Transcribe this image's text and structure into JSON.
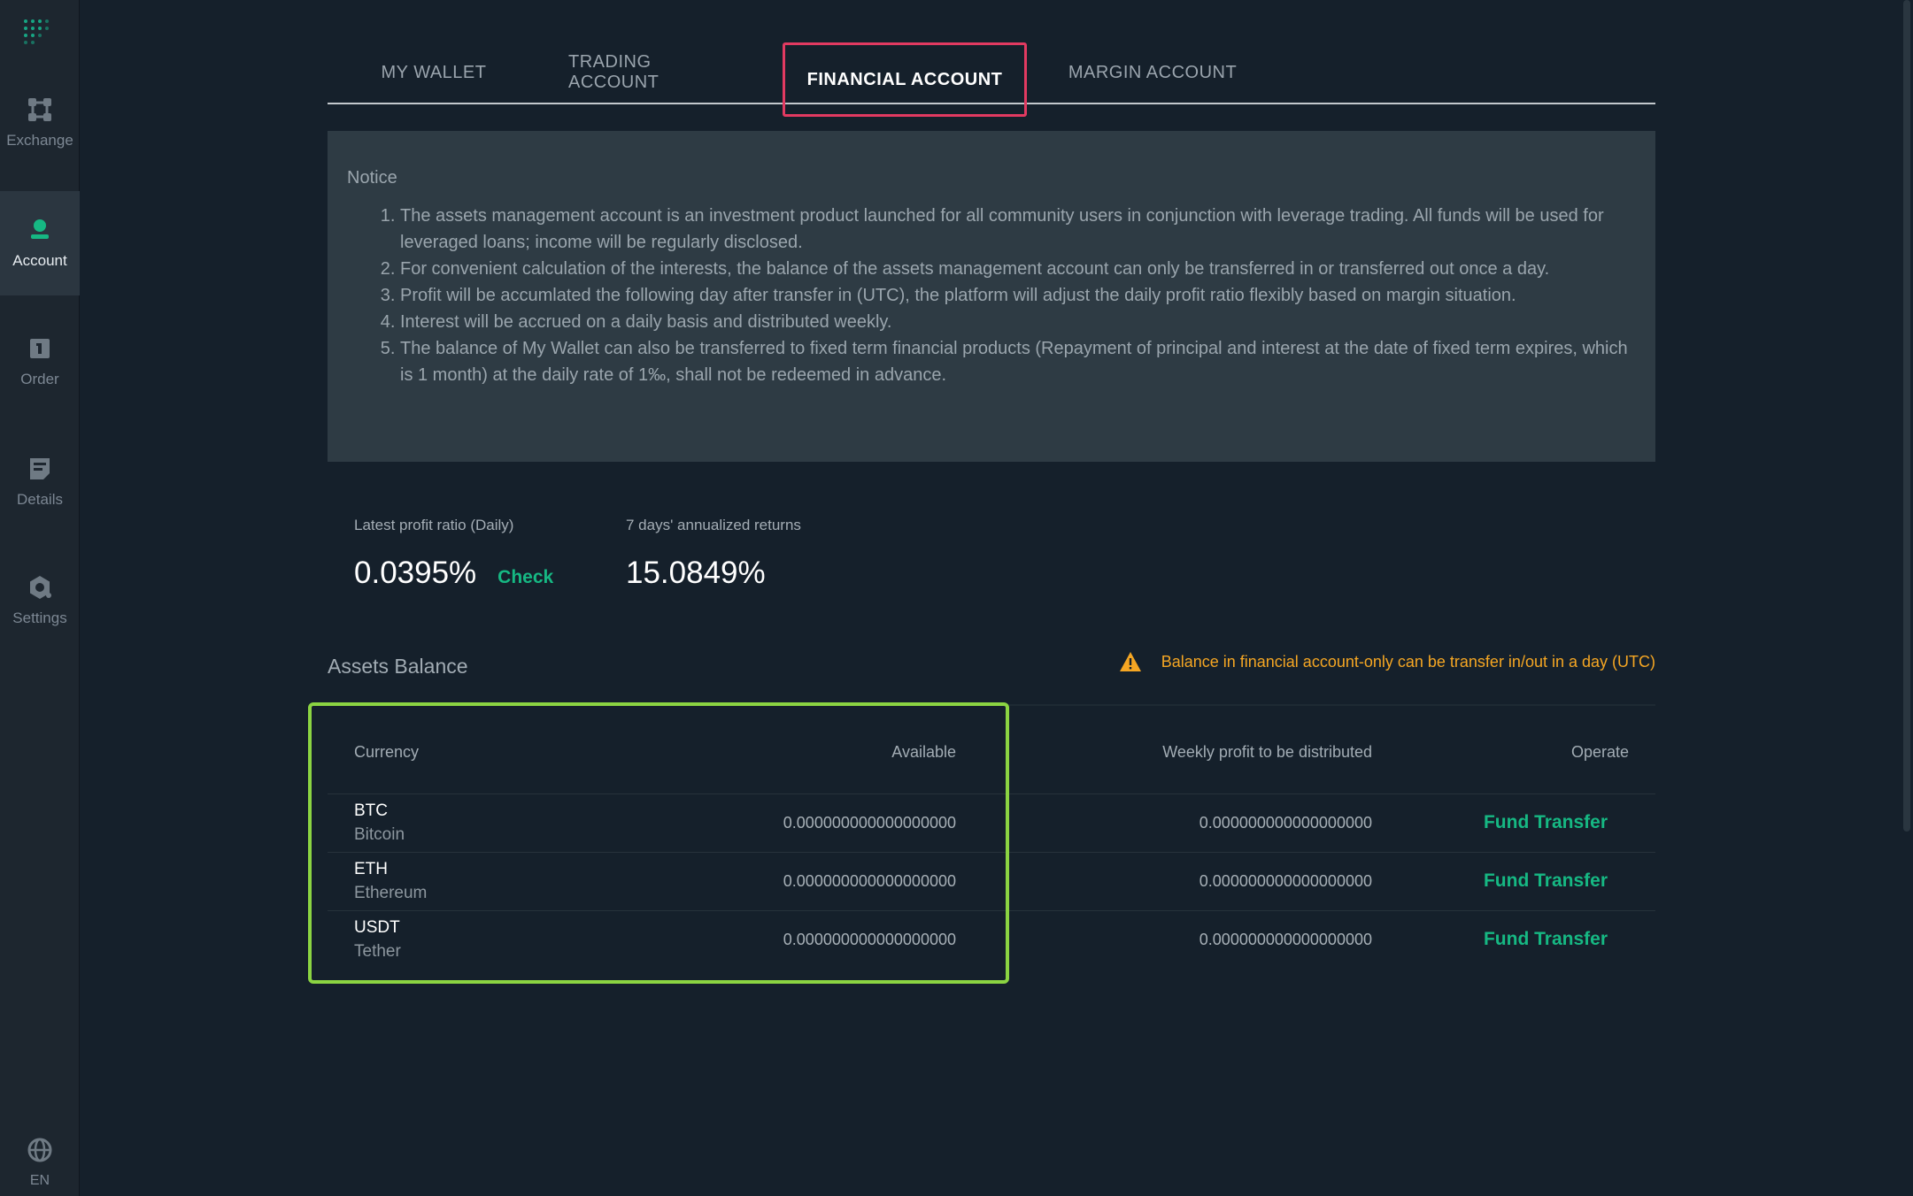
{
  "sidebar": {
    "items": [
      {
        "label": "Exchange",
        "icon": "exchange-icon"
      },
      {
        "label": "Account",
        "icon": "account-icon",
        "active": true
      },
      {
        "label": "Order",
        "icon": "order-icon"
      },
      {
        "label": "Details",
        "icon": "details-icon"
      },
      {
        "label": "Settings",
        "icon": "settings-icon"
      }
    ],
    "language": "EN"
  },
  "tabs": [
    {
      "label": "MY WALLET"
    },
    {
      "label": "TRADING ACCOUNT"
    },
    {
      "label": "FINANCIAL ACCOUNT",
      "active": true
    },
    {
      "label": "MARGIN ACCOUNT"
    }
  ],
  "notice": {
    "title": "Notice",
    "items": [
      "The assets management account is an investment product launched for all community users in conjunction with leverage trading. All funds will be used for leveraged loans; income will be regularly disclosed.",
      "For convenient calculation of the interests, the balance of the assets management account can only be transferred in or transferred out once a day.",
      "Profit will be accumlated the following day after transfer in (UTC), the platform will adjust the daily profit ratio flexibly based on margin situation.",
      "Interest will be accrued on a daily basis and distributed weekly.",
      "The balance of My Wallet can also be transferred to fixed term financial products (Repayment of principal and interest at the date of fixed term expires, which is 1 month) at the daily rate of 1‰, shall not be redeemed in advance."
    ]
  },
  "stats": {
    "profit_label": "Latest profit ratio (Daily)",
    "profit_value": "0.0395%",
    "check_label": "Check",
    "annual_label": "7 days' annualized returns",
    "annual_value": "15.0849%"
  },
  "assets": {
    "title": "Assets Balance",
    "warning": "Balance in financial account-only can be transfer in/out in a day (UTC)",
    "columns": {
      "currency": "Currency",
      "available": "Available",
      "weekly": "Weekly profit to be distributed",
      "operate": "Operate"
    },
    "rows": [
      {
        "symbol": "BTC",
        "name": "Bitcoin",
        "available": "0.000000000000000000",
        "weekly": "0.000000000000000000",
        "action": "Fund Transfer"
      },
      {
        "symbol": "ETH",
        "name": "Ethereum",
        "available": "0.000000000000000000",
        "weekly": "0.000000000000000000",
        "action": "Fund Transfer"
      },
      {
        "symbol": "USDT",
        "name": "Tether",
        "available": "0.000000000000000000",
        "weekly": "0.000000000000000000",
        "action": "Fund Transfer"
      }
    ]
  },
  "colors": {
    "accent": "#16b883",
    "warning": "#f5a623",
    "tab_highlight": "#e23a61",
    "table_highlight": "#8bd442"
  }
}
